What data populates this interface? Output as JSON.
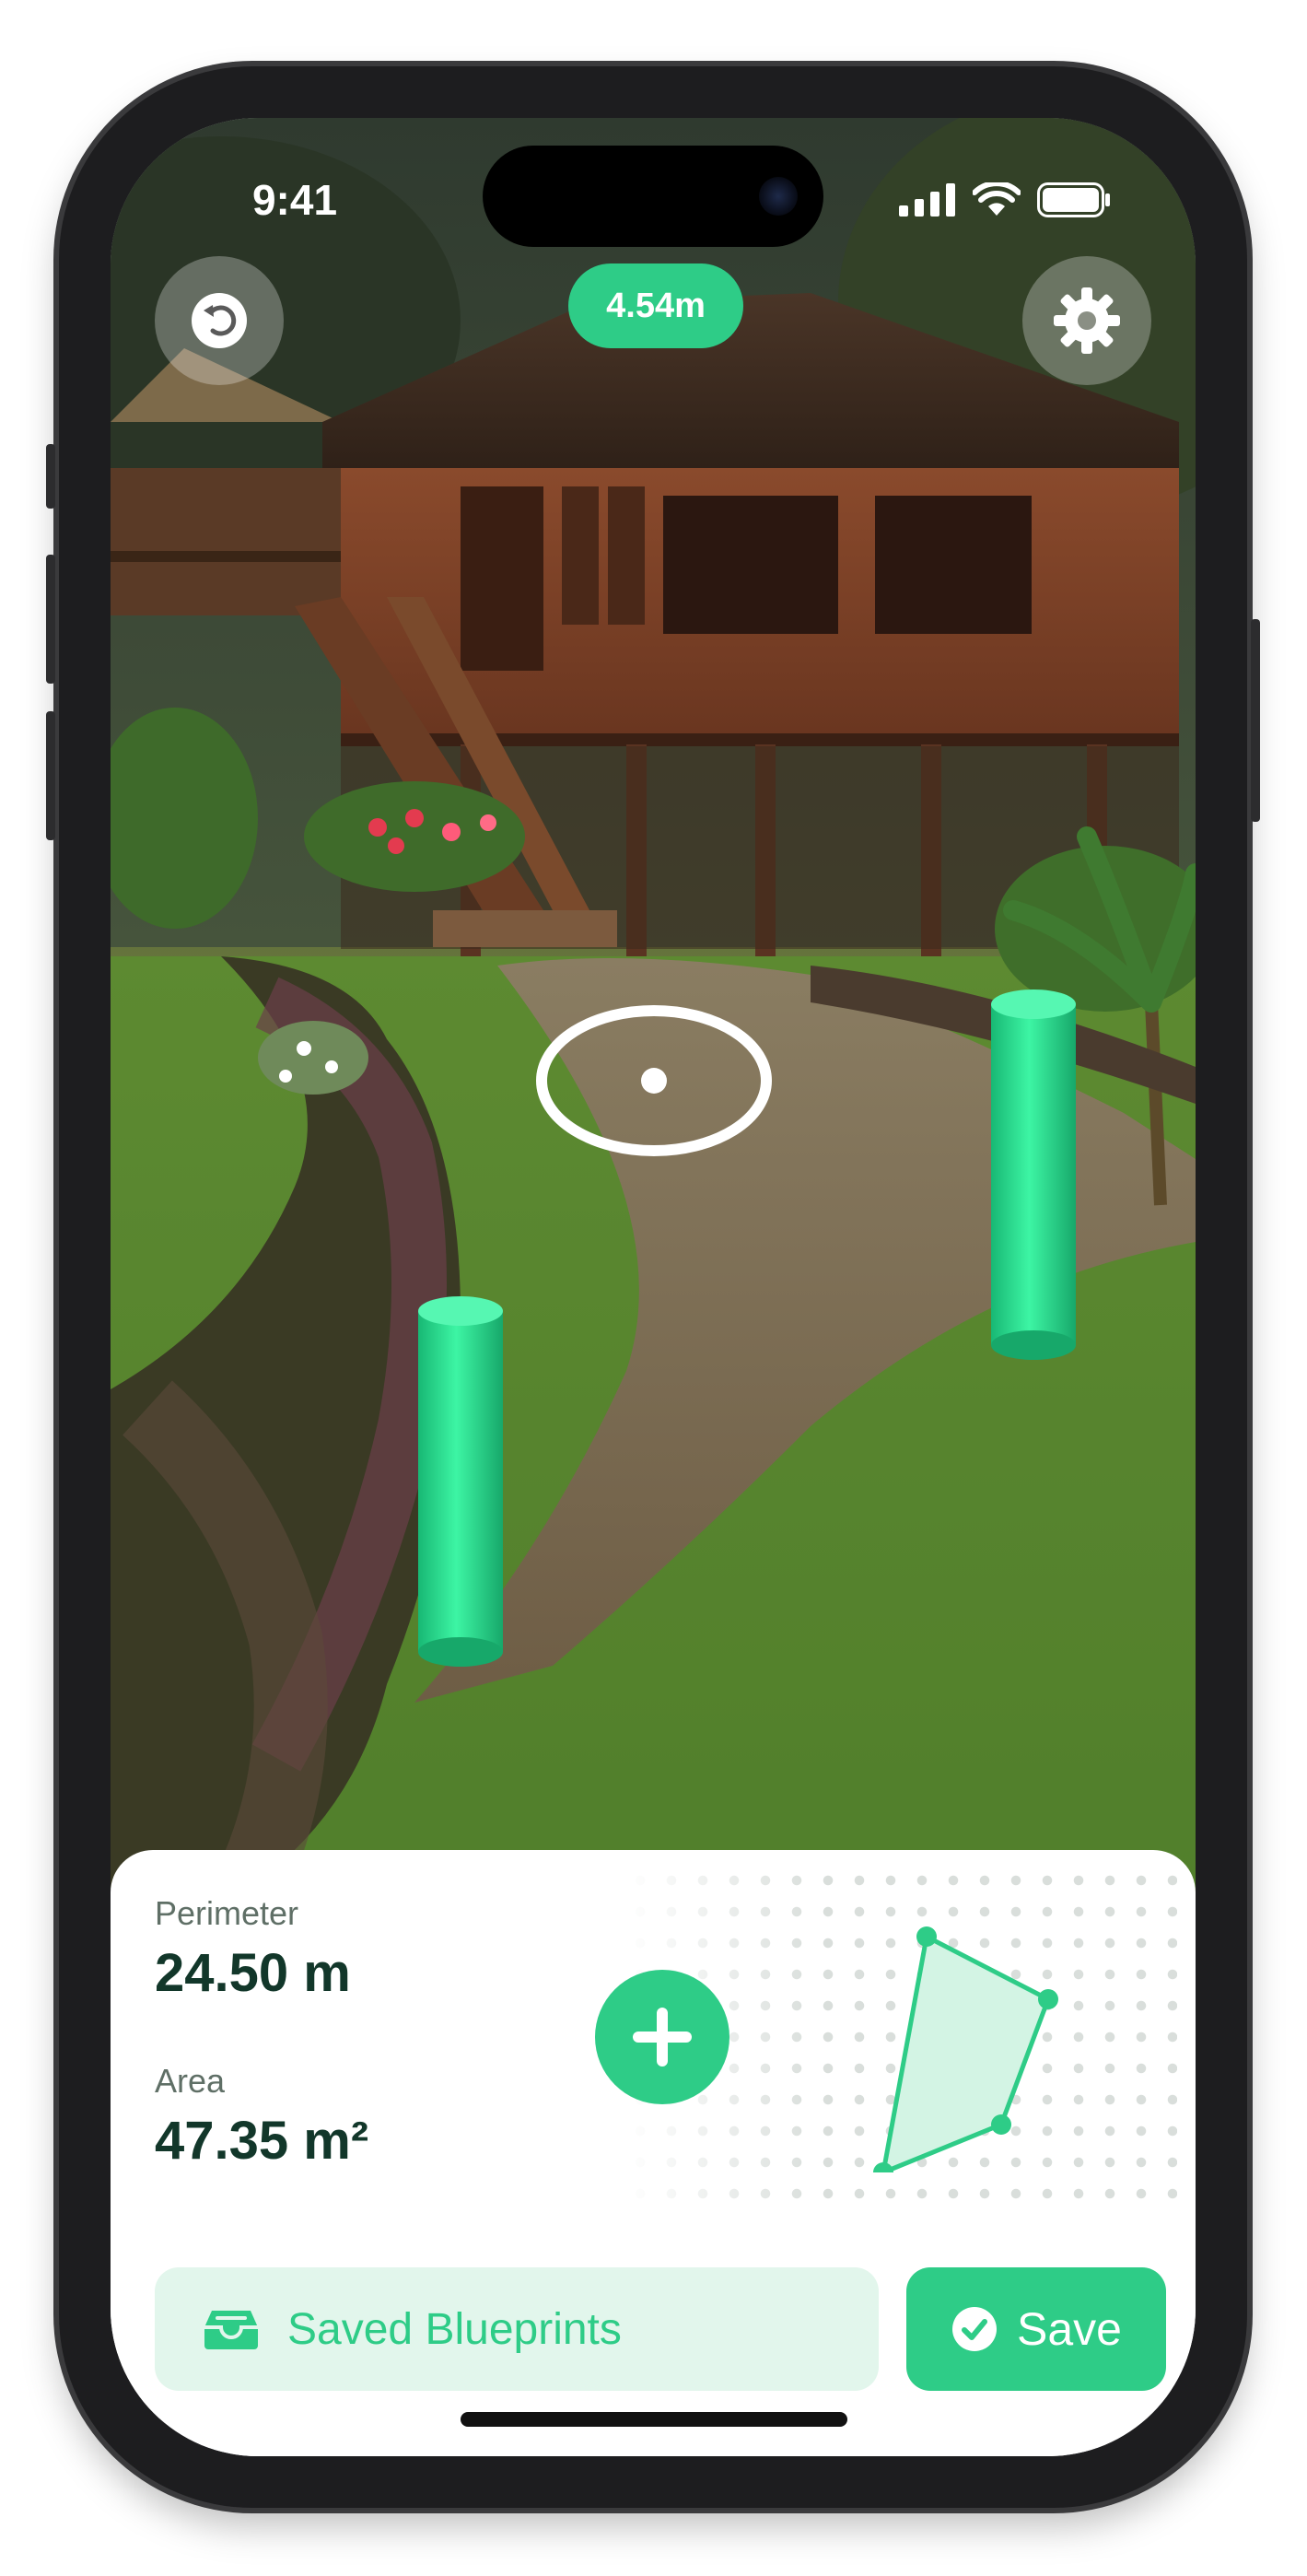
{
  "status_bar": {
    "time": "9:41",
    "icons": [
      "cellular-signal-icon",
      "wifi-icon",
      "battery-icon"
    ]
  },
  "top_bar": {
    "undo_icon": "undo-icon",
    "distance": "4.54m",
    "settings_icon": "gear-icon"
  },
  "stats": {
    "perimeter_label": "Perimeter",
    "perimeter_value": "24.50 m",
    "area_label": "Area",
    "area_value": "47.35 m²"
  },
  "actions": {
    "add_icon": "plus-icon",
    "saved_label": "Saved Blueprints",
    "saved_icon": "inbox-tray-icon",
    "save_label": "Save",
    "save_icon": "check-circle-icon"
  },
  "colors": {
    "accent": "#2ecc87",
    "accent_light": "#e2f6ec",
    "text_dark": "#12372a",
    "text_muted": "#5f6f66"
  }
}
